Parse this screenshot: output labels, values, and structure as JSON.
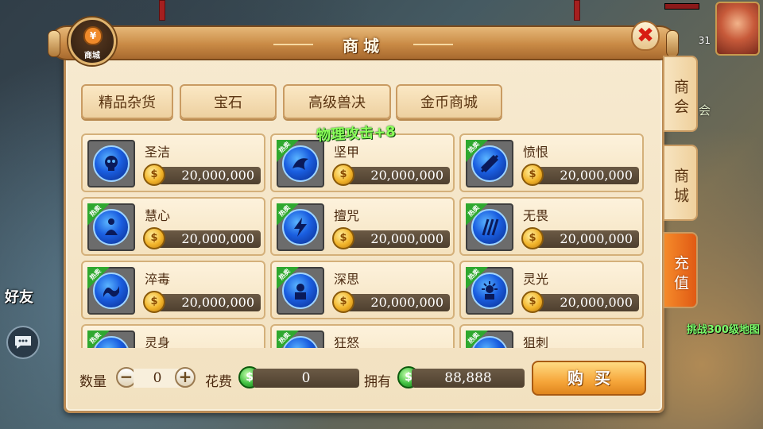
{
  "background": {
    "friend_label": "好友",
    "level_text": "31",
    "side_hint": "会",
    "challenge_text": "挑战300级地图"
  },
  "dialog": {
    "title": "商城",
    "badge_label": "商城",
    "close_symbol": "✖"
  },
  "category_tabs": [
    {
      "label": "精品杂货",
      "active": true
    },
    {
      "label": "宝石",
      "active": false
    },
    {
      "label": "高级兽决",
      "active": false
    },
    {
      "label": "金币商城",
      "active": false
    }
  ],
  "float_text": "物理攻击+8",
  "items": [
    {
      "name": "圣洁",
      "price": "20,000,000",
      "hot": false,
      "icon": "skull-icon"
    },
    {
      "name": "坚甲",
      "price": "20,000,000",
      "hot": true,
      "icon": "dragon-icon"
    },
    {
      "name": "愤恨",
      "price": "20,000,000",
      "hot": true,
      "icon": "slash-icon"
    },
    {
      "name": "慧心",
      "price": "20,000,000",
      "hot": true,
      "icon": "meditation-icon"
    },
    {
      "name": "擅咒",
      "price": "20,000,000",
      "hot": true,
      "icon": "lightning-icon"
    },
    {
      "name": "无畏",
      "price": "20,000,000",
      "hot": true,
      "icon": "claw-icon"
    },
    {
      "name": "淬毒",
      "price": "20,000,000",
      "hot": true,
      "icon": "serpent-icon"
    },
    {
      "name": "深思",
      "price": "20,000,000",
      "hot": true,
      "icon": "thinker-icon"
    },
    {
      "name": "灵光",
      "price": "20,000,000",
      "hot": true,
      "icon": "radiance-icon"
    },
    {
      "name": "灵身",
      "price": "",
      "hot": true,
      "icon": "spirit-icon"
    },
    {
      "name": "狂怒",
      "price": "",
      "hot": true,
      "icon": "rage-icon"
    },
    {
      "name": "狙刺",
      "price": "",
      "hot": true,
      "icon": "pierce-icon"
    }
  ],
  "hot_label": "热卖",
  "bottom": {
    "quantity_label": "数量",
    "quantity_value": "0",
    "minus": "−",
    "plus": "+",
    "cost_label": "花费",
    "cost_value": "0",
    "owned_label": "拥有",
    "owned_value": "88,888",
    "buy_label": "购买"
  },
  "side_tabs": [
    {
      "label": "商会",
      "active": false
    },
    {
      "label": "商城",
      "active": false
    },
    {
      "label": "充值",
      "active": true
    }
  ],
  "colors": {
    "hot_ribbon": "#2fa82f",
    "active_side_tab": "#e05a14",
    "close_x": "#d81c12"
  }
}
